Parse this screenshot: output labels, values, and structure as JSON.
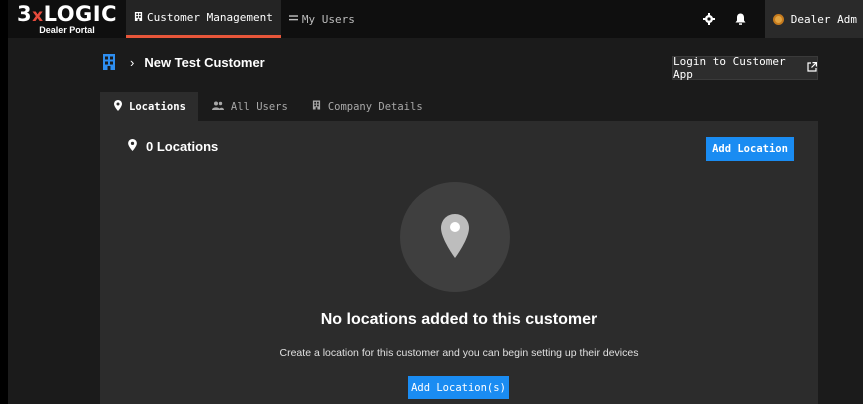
{
  "app": {
    "logo_main_a": "3",
    "logo_main_x": "x",
    "logo_main_b": "LOGIC",
    "logo_sub": "Dealer Portal"
  },
  "topnav": {
    "tabs": [
      {
        "label": "Customer Management",
        "icon": "building-icon",
        "active": true
      },
      {
        "label": "My Users",
        "icon": "users-icon",
        "active": false
      }
    ],
    "user_label": "Dealer Adm"
  },
  "header": {
    "customer_name": "New Test Customer",
    "login_button": "Login to Customer App"
  },
  "subtabs": [
    {
      "label": "Locations",
      "icon": "map-pin-icon",
      "active": true
    },
    {
      "label": "All Users",
      "icon": "users-icon",
      "active": false
    },
    {
      "label": "Company Details",
      "icon": "building-icon",
      "active": false
    }
  ],
  "panel": {
    "title": "0 Locations",
    "add_button": "Add Location",
    "empty_title": "No locations added to this customer",
    "empty_desc": "Create a location for this customer and you can begin setting up their devices",
    "empty_button": "Add Location(s)"
  },
  "colors": {
    "accent_blue": "#1a8cf2",
    "active_tab_underline": "#e8563a",
    "logo_x": "#e84b3c"
  }
}
